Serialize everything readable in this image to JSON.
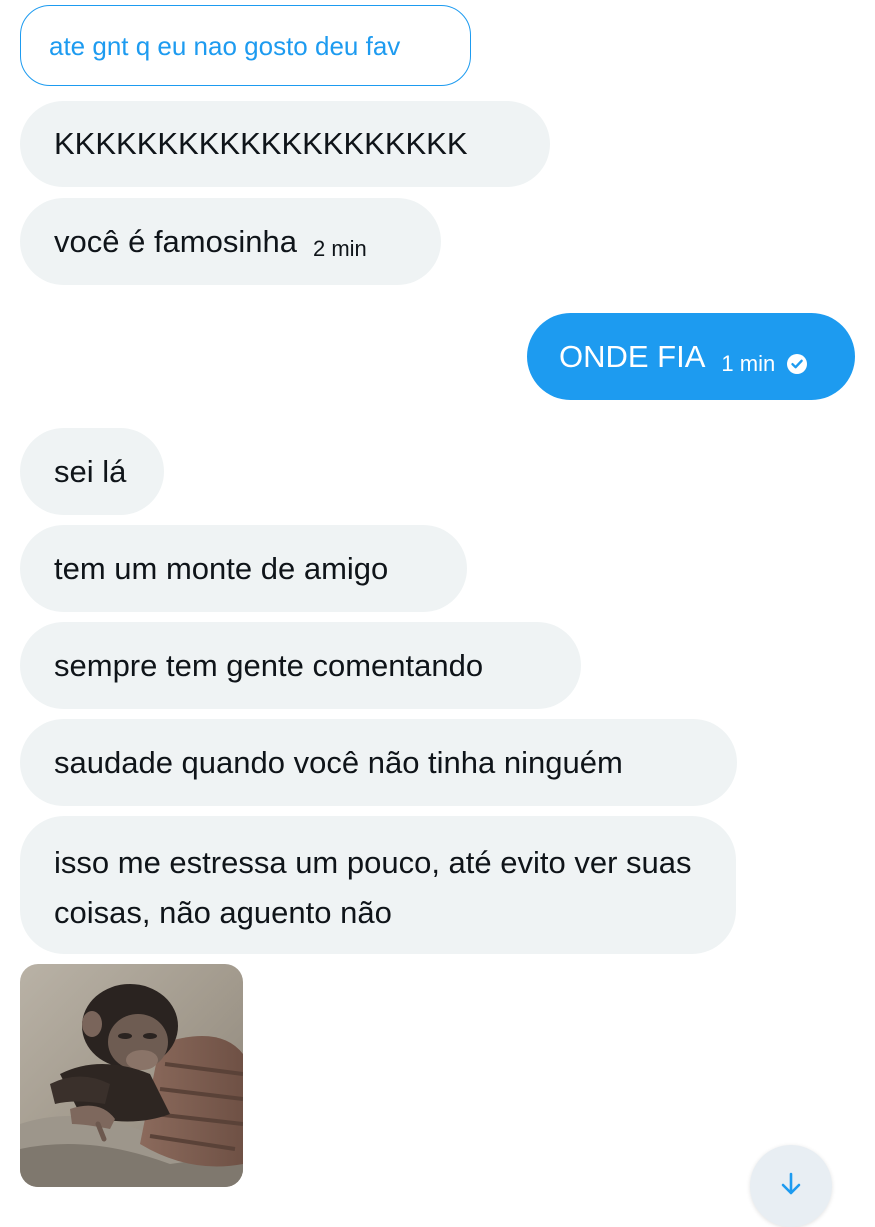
{
  "conversation": {
    "reply_preview": "ate gnt q eu nao gosto deu fav",
    "messages": [
      {
        "direction": "in",
        "text": "KKKKKKKKKKKKKKKKKKKK"
      },
      {
        "direction": "in",
        "text": "você é famosinha",
        "time": "2 min"
      },
      {
        "direction": "out",
        "text": "ONDE FIA",
        "time": "1 min",
        "status": "read"
      },
      {
        "direction": "in",
        "text": "sei lá"
      },
      {
        "direction": "in",
        "text": "tem um monte de amigo"
      },
      {
        "direction": "in",
        "text": "sempre tem gente comentando"
      },
      {
        "direction": "in",
        "text": "saudade quando você não tinha ninguém"
      },
      {
        "direction": "in",
        "text": "isso me estressa um pouco, até evito ver suas coisas, não aguento não"
      },
      {
        "direction": "in",
        "type": "gif",
        "icon": "chimpanzee-gif-image"
      }
    ]
  },
  "controls": {
    "scroll_down_icon": "arrow-down-icon"
  },
  "colors": {
    "accent": "#1d9bf0",
    "incoming_bubble": "#eff3f4",
    "text": "#0f1419"
  }
}
